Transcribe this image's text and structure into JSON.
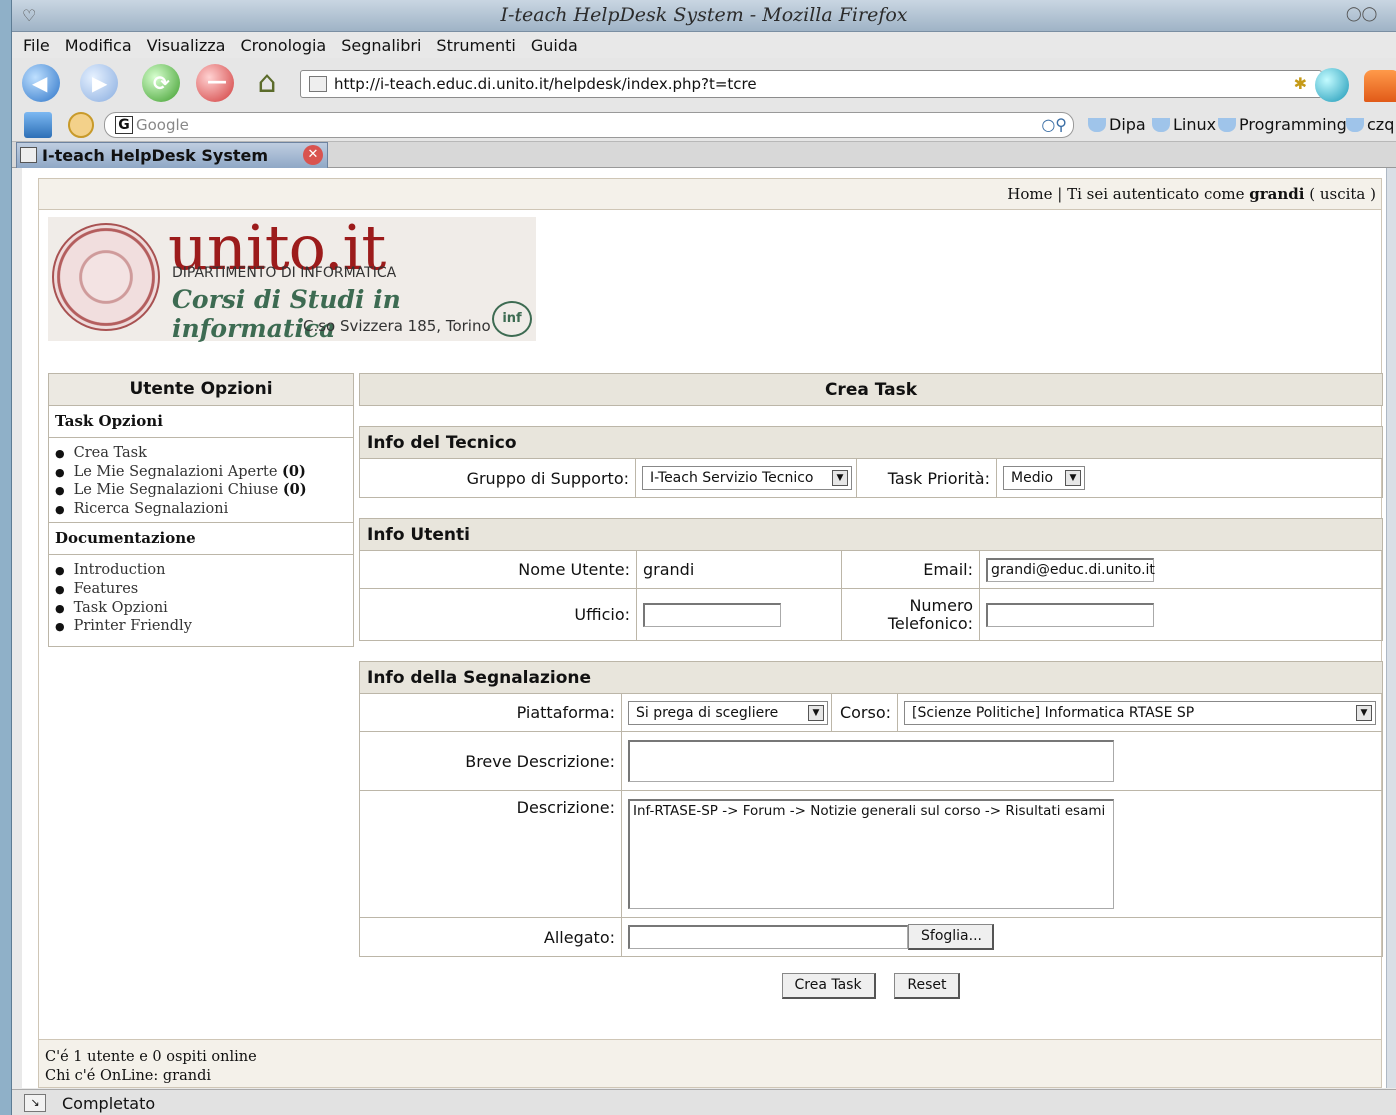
{
  "window": {
    "title": "I-teach HelpDesk System - Mozilla Firefox"
  },
  "menu": [
    "File",
    "Modifica",
    "Visualizza",
    "Cronologia",
    "Segnalibri",
    "Strumenti",
    "Guida"
  ],
  "nav": {
    "url": "http://i-teach.educ.di.unito.it/helpdesk/index.php?t=tcre"
  },
  "search": {
    "placeholder": "Google"
  },
  "bookmarks": [
    "Dipa",
    "Linux",
    "Programming",
    "czq"
  ],
  "tab": {
    "title": "I-teach HelpDesk System"
  },
  "top": {
    "home": "Home",
    "sep": " | ",
    "auth_prefix": "Ti sei autenticato come ",
    "user": "grandi",
    "logout": " ( uscita )"
  },
  "logo": {
    "name": "unito.it",
    "dept": "DIPARTIMENTO DI INFORMATICA",
    "tagline": "Corsi di Studi in informatica",
    "address": "C.so Svizzera 185, Torino",
    "mark": "inf"
  },
  "sidebar": {
    "title": "Utente Opzioni",
    "task_title": "Task Opzioni",
    "task_items": [
      {
        "label": "Crea Task",
        "count": ""
      },
      {
        "label": "Le Mie Segnalazioni Aperte",
        "count": "(0)"
      },
      {
        "label": "Le Mie Segnalazioni Chiuse",
        "count": "(0)"
      },
      {
        "label": "Ricerca Segnalazioni",
        "count": ""
      }
    ],
    "doc_title": "Documentazione",
    "doc_items": [
      "Introduction",
      "Features",
      "Task Opzioni",
      "Printer Friendly"
    ]
  },
  "main": {
    "title": "Crea Task",
    "tech": {
      "title": "Info del Tecnico",
      "group_label": "Gruppo di Supporto:",
      "group_value": "I-Teach Servizio Tecnico",
      "priority_label": "Task Priorità:",
      "priority_value": "Medio"
    },
    "users": {
      "title": "Info Utenti",
      "name_label": "Nome Utente:",
      "name_value": "grandi",
      "email_label": "Email:",
      "email_value": "grandi@educ.di.unito.it",
      "office_label": "Ufficio:",
      "office_value": "",
      "phone_label": "Numero Telefonico:",
      "phone_value": ""
    },
    "report": {
      "title": "Info della Segnalazione",
      "platform_label": "Piattaforma:",
      "platform_value": "Si prega di scegliere",
      "course_label": "Corso:",
      "course_value": "[Scienze Politiche] Informatica RTASE SP",
      "short_label": "Breve Descrizione:",
      "short_value": "",
      "desc_label": "Descrizione:",
      "desc_value": "Inf-RTASE-SP -> Forum -> Notizie generali sul corso -> Risultati esami",
      "attach_label": "Allegato:",
      "browse_label": "Sfoglia..."
    },
    "submit_label": "Crea Task",
    "reset_label": "Reset"
  },
  "footer": {
    "online": "C'é 1 utente e 0 ospiti online",
    "who": "Chi c'é OnLine: grandi"
  },
  "status": {
    "text": "Completato"
  }
}
